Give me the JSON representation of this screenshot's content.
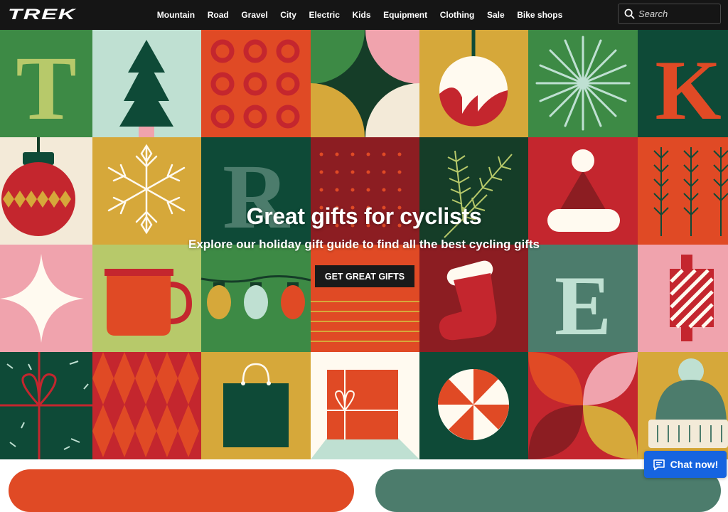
{
  "brand": {
    "logo_alt": "TREK"
  },
  "nav": {
    "items": [
      "Mountain",
      "Road",
      "Gravel",
      "City",
      "Electric",
      "Kids",
      "Equipment",
      "Clothing",
      "Sale",
      "Bike shops"
    ]
  },
  "search": {
    "placeholder": "Search",
    "icon": "search-icon"
  },
  "hero": {
    "title": "Great gifts for cyclists",
    "subtitle": "Explore our holiday gift guide to find all the best cycling gifts",
    "cta_label": "GET GREAT GIFTS"
  },
  "chat": {
    "label": "Chat now!",
    "icon": "chat-bubble-icon"
  },
  "colors": {
    "nav_bg": "#151515",
    "green": "#3d8a45",
    "dark_green": "#0e4a37",
    "red": "#c4262e",
    "orange_red": "#e04a25",
    "mustard": "#d6a83a",
    "pink": "#f0a3ad",
    "mint": "#bfe0d2",
    "teal": "#4c7c6c",
    "cream": "#f3ead8",
    "chat_blue": "#1664e0"
  }
}
